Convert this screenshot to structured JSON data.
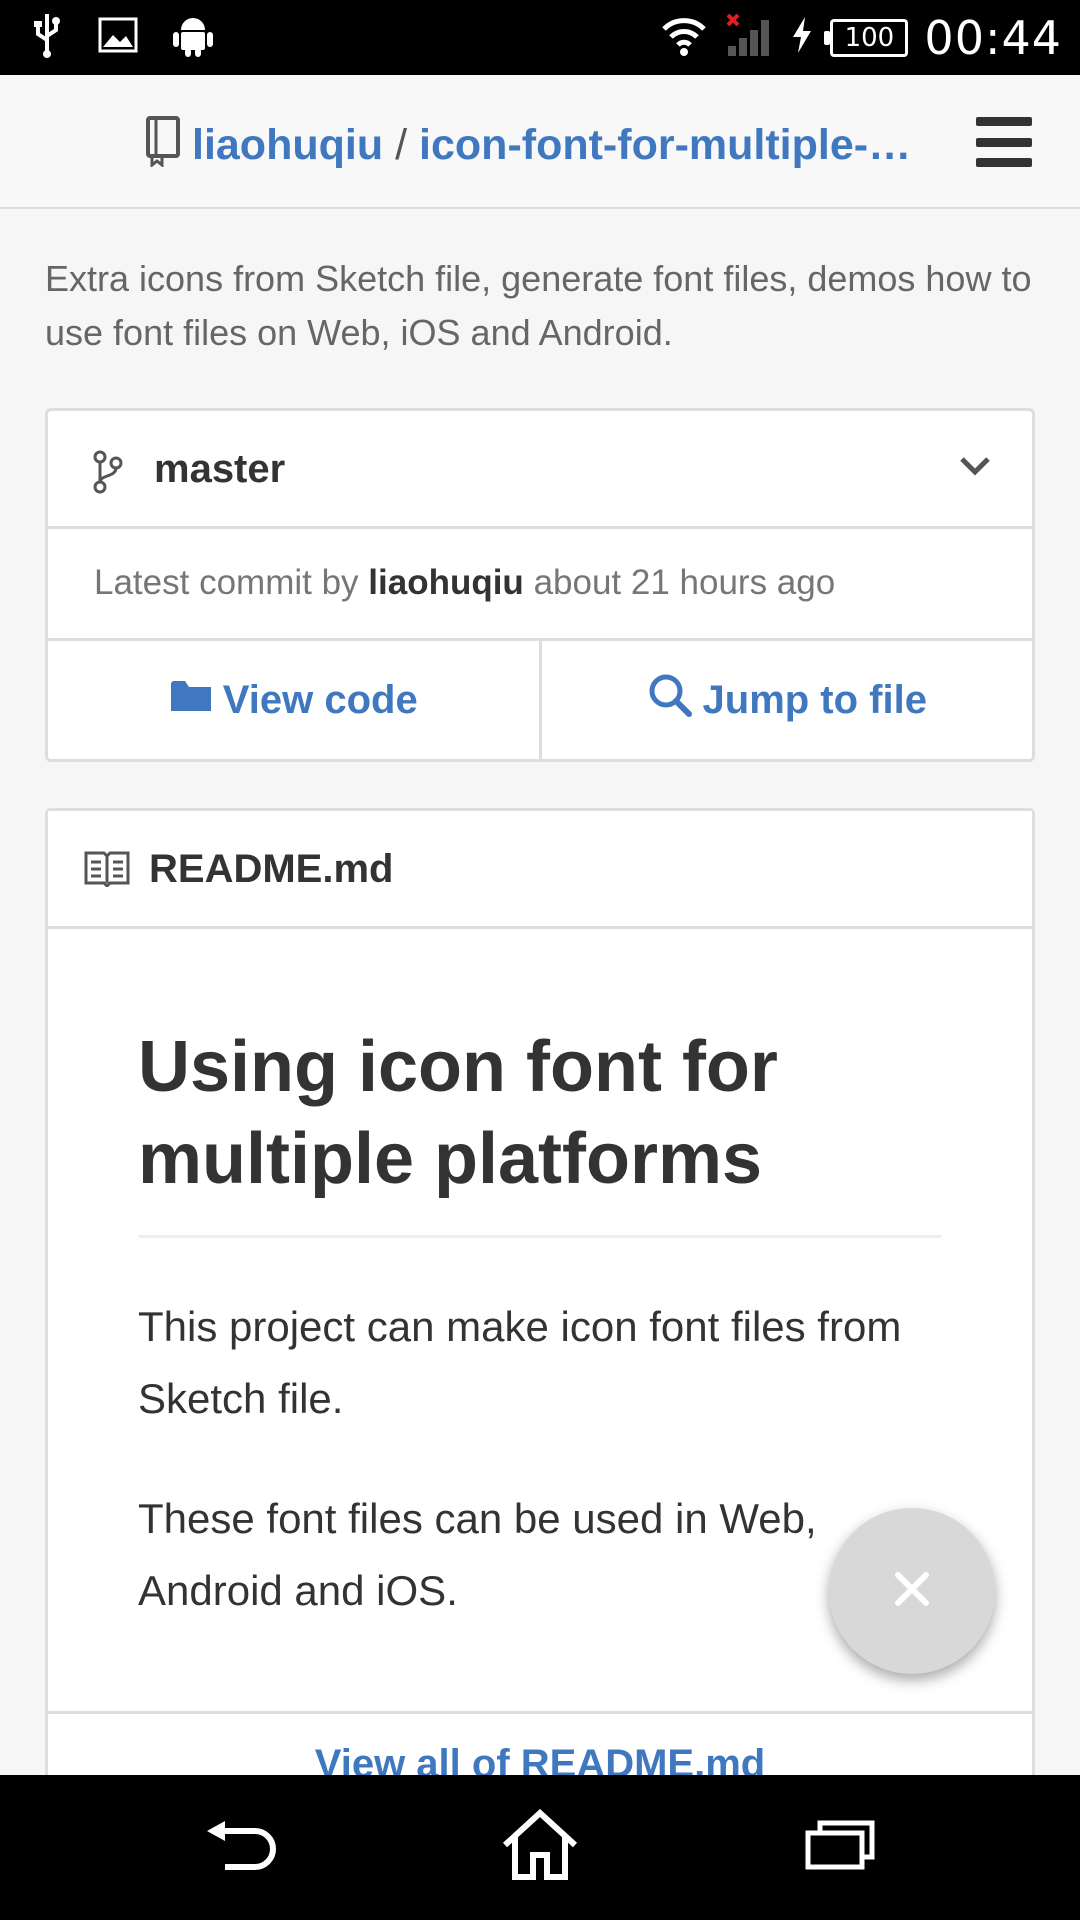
{
  "status_bar": {
    "time": "00:44",
    "battery": "100",
    "icons": [
      "usb-icon",
      "image-icon",
      "android-icon",
      "wifi-icon",
      "signal-icon",
      "charging-icon",
      "battery-icon"
    ]
  },
  "header": {
    "owner": "liaohuqiu",
    "separator": "/",
    "repo": "icon-font-for-multiple-plat…"
  },
  "description": "Extra icons from Sketch file, generate font files, demos how to use font files on Web, iOS and Android.",
  "branch": {
    "name": "master"
  },
  "commit": {
    "prefix": "Latest commit by",
    "author": "liaohuqiu",
    "time": "about 21 hours ago"
  },
  "actions": {
    "view_code": "View code",
    "jump_to_file": "Jump to file"
  },
  "readme": {
    "filename": "README.md",
    "heading": "Using icon font for multiple platforms",
    "paragraph1": "This project can make icon font files from Sketch file.",
    "paragraph2": "These font files can be used in Web, Android and iOS.",
    "view_all": "View all of README.md"
  },
  "colors": {
    "link": "#4078c0",
    "text": "#333333",
    "muted": "#767676",
    "border": "#dddddd"
  }
}
